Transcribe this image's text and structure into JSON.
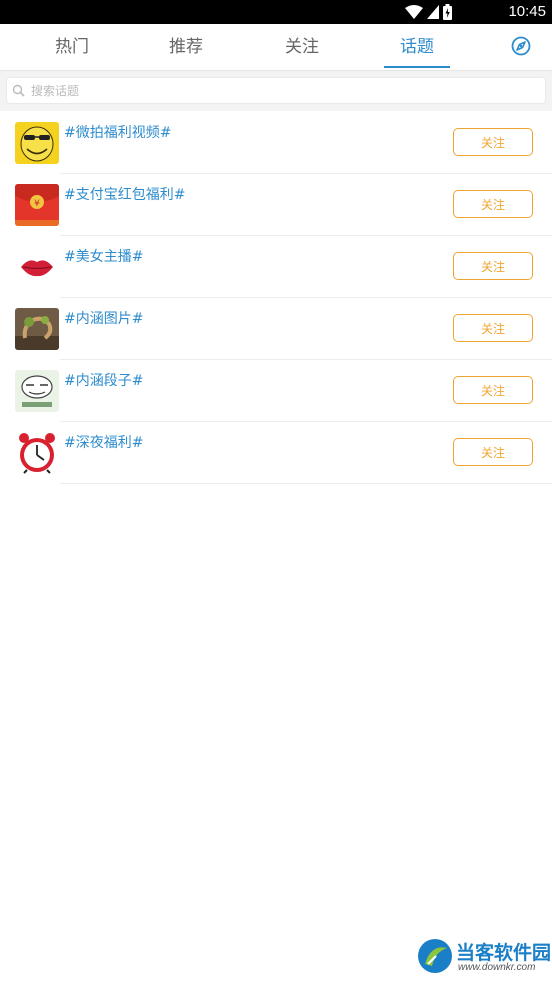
{
  "status": {
    "time": "10:45"
  },
  "tabs": [
    {
      "label": "热门"
    },
    {
      "label": "推荐"
    },
    {
      "label": "关注"
    },
    {
      "label": "话题"
    }
  ],
  "active_tab": "话题",
  "search": {
    "placeholder": "搜索话题",
    "value": ""
  },
  "topics": [
    {
      "title": "#微拍福利视频#",
      "follow_label": "关注",
      "icon": "sunglasses-face-icon"
    },
    {
      "title": "#支付宝红包福利#",
      "follow_label": "关注",
      "icon": "red-envelope-icon"
    },
    {
      "title": "#美女主播#",
      "follow_label": "关注",
      "icon": "lips-icon"
    },
    {
      "title": "#内涵图片#",
      "follow_label": "关注",
      "icon": "tree-photo-icon"
    },
    {
      "title": "#内涵段子#",
      "follow_label": "关注",
      "icon": "meme-face-icon"
    },
    {
      "title": "#深夜福利#",
      "follow_label": "关注",
      "icon": "alarm-clock-icon"
    }
  ],
  "watermark": {
    "name": "当客软件园",
    "url": "www.downkr.com"
  },
  "colors": {
    "accent": "#2e8ccd",
    "follow": "#f0a432",
    "divider": "#ececec"
  }
}
